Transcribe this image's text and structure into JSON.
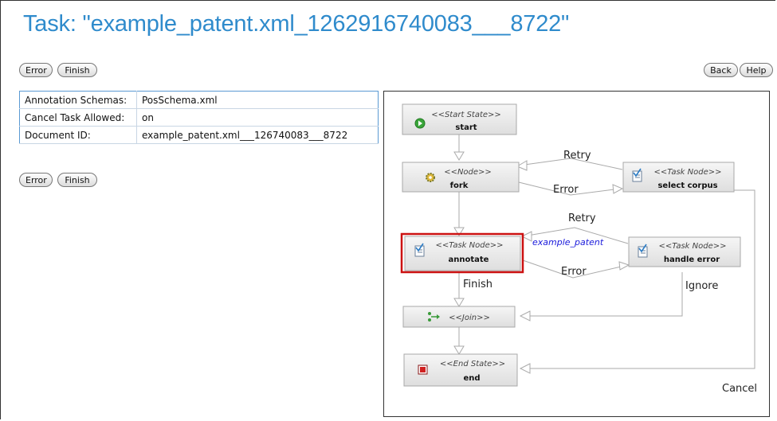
{
  "page": {
    "title": "Task: \"example_patent.xml_1262916740083___8722\""
  },
  "toolbar": {
    "error_label": "Error",
    "finish_label": "Finish",
    "back_label": "Back",
    "help_label": "Help"
  },
  "info_rows": [
    {
      "label": "Annotation Schemas:",
      "value": "PosSchema.xml"
    },
    {
      "label": "Cancel Task Allowed:",
      "value": "on"
    },
    {
      "label": "Document ID:",
      "value": "example_patent.xml___126740083___8722"
    }
  ],
  "workflow": {
    "nodes": {
      "start": {
        "stereotype": "<<Start State>>",
        "name": "start",
        "icon": "play-icon"
      },
      "fork": {
        "stereotype": "<<Node>>",
        "name": "fork",
        "icon": "gear-icon"
      },
      "select_corpus": {
        "stereotype": "<<Task Node>>",
        "name": "select corpus",
        "icon": "task-icon"
      },
      "annotate": {
        "stereotype": "<<Task Node>>",
        "name": "annotate",
        "icon": "task-icon"
      },
      "handle_error": {
        "stereotype": "<<Task Node>>",
        "name": "handle error",
        "icon": "task-icon"
      },
      "join": {
        "stereotype": "<<Join>>",
        "name": "",
        "icon": "join-icon"
      },
      "end": {
        "stereotype": "<<End State>>",
        "name": "end",
        "icon": "stop-icon"
      }
    },
    "edge_labels": {
      "retry_top": "Retry",
      "error_top": "Error",
      "retry_mid": "Retry",
      "example_patent": "example_patent",
      "error_mid": "Error",
      "finish": "Finish",
      "ignore": "Ignore",
      "cancel": "Cancel"
    },
    "colors": {
      "highlight": "#cc1111",
      "link_text": "#1a1adb",
      "node_fill": "#e9e9e9",
      "node_border": "#a8a8a8"
    }
  }
}
